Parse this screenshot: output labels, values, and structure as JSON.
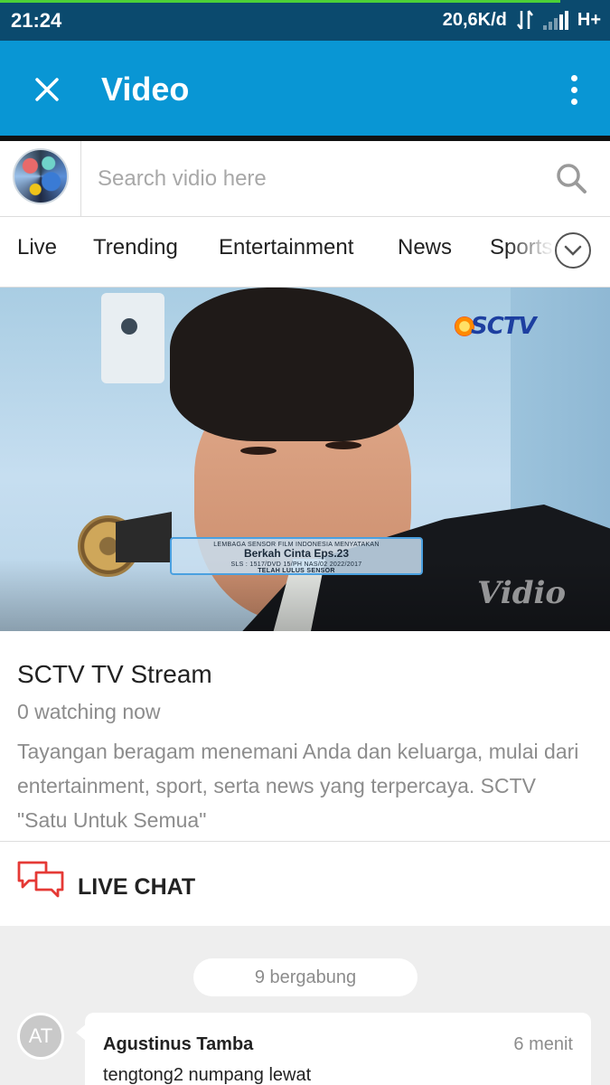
{
  "status_bar": {
    "time": "21:24",
    "network_speed": "20,6K/d",
    "network_type": "H+",
    "icons": [
      "data-transfer-icon",
      "signal-icon"
    ]
  },
  "app_bar": {
    "title": "Video",
    "close_icon": "close-icon",
    "menu_icon": "more-vert-icon",
    "color": "#0996d4"
  },
  "search": {
    "placeholder": "Search vidio here",
    "value": "",
    "icon": "search-icon"
  },
  "tabs": [
    {
      "label": "Live"
    },
    {
      "label": "Trending"
    },
    {
      "label": "Entertainment"
    },
    {
      "label": "News"
    },
    {
      "label": "Sports"
    }
  ],
  "tabs_expand_icon": "chevron-down-icon",
  "video": {
    "channel_logo": "SCTV",
    "watermark": "Vidio",
    "overlay_top": "LEMBAGA SENSOR FILM INDONESIA MENYATAKAN",
    "overlay_title": "Berkah Cinta Eps.23",
    "overlay_sub": "SLS : 1517/DVD 15/PH NAS/02 2022/2017",
    "overlay_bottom": "TELAH LULUS SENSOR"
  },
  "stream": {
    "title": "SCTV TV Stream",
    "watching": "0 watching now",
    "description": "Tayangan beragam menemani Anda dan keluarga, mulai dari entertainment, sport, serta news yang terpercaya. SCTV \"Satu Untuk Semua\""
  },
  "chat": {
    "header": "LIVE CHAT",
    "icon": "chat-bubbles-icon",
    "icon_color": "#e53935",
    "joined": "9 bergabung",
    "messages": [
      {
        "initials": "AT",
        "name": "Agustinus Tamba",
        "time": "6 menit",
        "text": "tengtong2 numpang lewat"
      }
    ]
  }
}
